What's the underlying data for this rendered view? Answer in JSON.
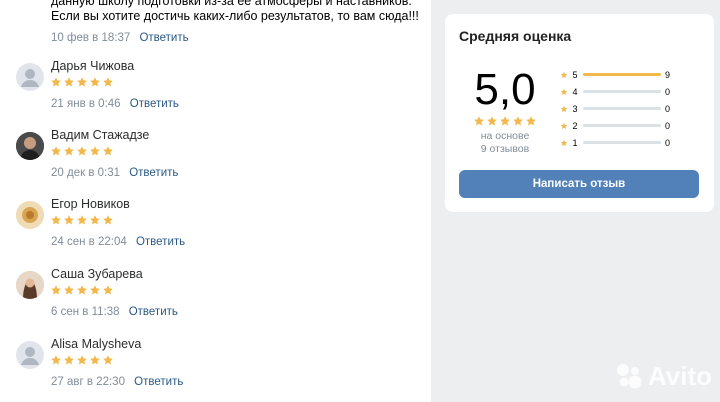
{
  "review_top": {
    "text": "данную школу подготовки из-за ее атмосферы и наставников. Если вы хотите достичь каких-либо результатов, то вам сюда!!!",
    "date": "10 фев в 18:37",
    "reply_label": "Ответить"
  },
  "reviews": [
    {
      "name": "Дарья Чижова",
      "date": "21 янв в 0:46",
      "reply_label": "Ответить",
      "rating": 5
    },
    {
      "name": "Вадим Стажадзе",
      "date": "20 дек в 0:31",
      "reply_label": "Ответить",
      "rating": 5
    },
    {
      "name": "Егор Новиков",
      "date": "24 сен в 22:04",
      "reply_label": "Ответить",
      "rating": 5
    },
    {
      "name": "Саша Зубарева",
      "date": "6 сен в 11:38",
      "reply_label": "Ответить",
      "rating": 5
    },
    {
      "name": "Alisa Malysheva",
      "date": "27 авг в 22:30",
      "reply_label": "Ответить",
      "rating": 5
    }
  ],
  "rating_card": {
    "title": "Средняя оценка",
    "average": "5,0",
    "based_on": "на основе",
    "reviews_count": "9 отзывов",
    "distribution": [
      {
        "stars": "5",
        "count": "9",
        "fraction": 1.0
      },
      {
        "stars": "4",
        "count": "0",
        "fraction": 0
      },
      {
        "stars": "3",
        "count": "0",
        "fraction": 0
      },
      {
        "stars": "2",
        "count": "0",
        "fraction": 0
      },
      {
        "stars": "1",
        "count": "0",
        "fraction": 0
      }
    ],
    "write_button": "Написать отзыв"
  },
  "colors": {
    "star": "#f2b84b",
    "button": "#5181b8",
    "link": "#2a5885"
  },
  "watermark": {
    "text": "Avito"
  }
}
